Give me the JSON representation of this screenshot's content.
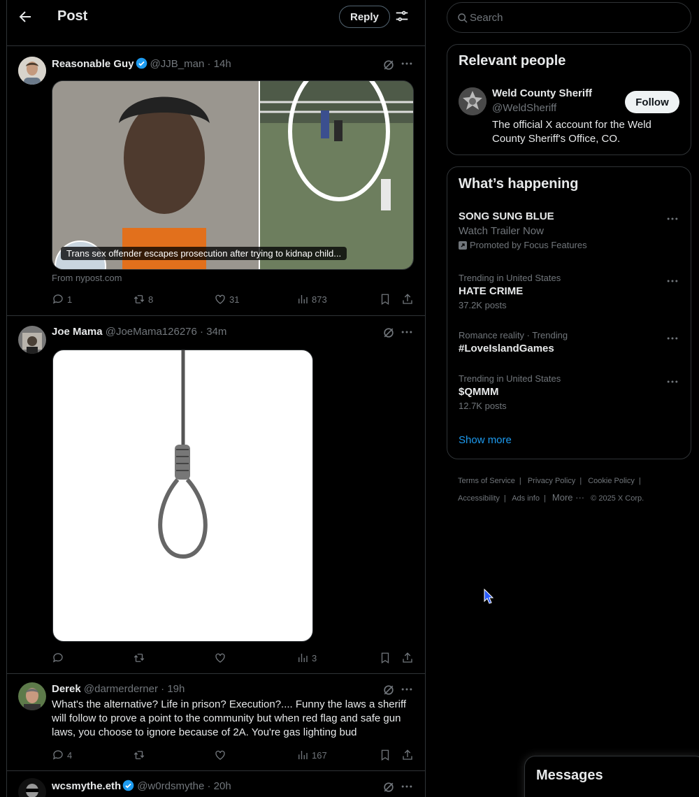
{
  "header": {
    "title": "Post",
    "reply_label": "Reply"
  },
  "tweets": [
    {
      "name": "Reasonable Guy",
      "handle": "@JJB_man",
      "time": "· 14h",
      "verified": true,
      "card_caption": "Trans sex offender escapes prosecution after trying to kidnap child...",
      "card_source": "From nypost.com",
      "replies": "1",
      "reposts": "8",
      "likes": "31",
      "views": "873"
    },
    {
      "name": "Joe Mama",
      "handle": "@JoeMama126276",
      "time": "· 34m",
      "verified": false,
      "replies": "",
      "reposts": "",
      "likes": "",
      "views": "3"
    },
    {
      "name": "Derek",
      "handle": "@darmerderner",
      "time": "· 19h",
      "verified": false,
      "text": "What's the alternative? Life in prison? Execution?.... Funny the laws a sheriff will follow to prove a point to the community but when red flag and safe gun laws, you choose to ignore because of 2A. You're gas lighting bud",
      "replies": "4",
      "reposts": "",
      "likes": "",
      "views": "167"
    },
    {
      "name": "wcsmythe.eth",
      "handle": "@w0rdsmythe",
      "time": "· 20h",
      "verified": true
    }
  ],
  "search": {
    "placeholder": "Search"
  },
  "relevant": {
    "title": "Relevant people",
    "name": "Weld County Sheriff",
    "handle": "@WeldSheriff",
    "bio": "The official X account for the Weld County Sheriff's Office, CO.",
    "follow_label": "Follow"
  },
  "happening": {
    "title": "What’s happening",
    "promo": {
      "topic": "SONG SUNG BLUE",
      "sub": "Watch Trailer Now",
      "promoted": "Promoted by Focus Features"
    },
    "trends": [
      {
        "meta": "Trending in United States",
        "topic": "HATE CRIME",
        "count": "37.2K posts"
      },
      {
        "meta": "Romance reality · Trending",
        "topic": "#LoveIslandGames",
        "count": ""
      },
      {
        "meta": "Trending in United States",
        "topic": "$QMMM",
        "count": "12.7K posts"
      }
    ],
    "show_more": "Show more"
  },
  "footer": {
    "terms": "Terms of Service",
    "privacy": "Privacy Policy",
    "cookie": "Cookie Policy",
    "accessibility": "Accessibility",
    "ads": "Ads info",
    "more": "More ···",
    "copyright": "© 2025 X Corp."
  },
  "messages": {
    "title": "Messages"
  },
  "colors": {
    "accent": "#1d9bf0",
    "border": "#2f3336",
    "muted": "#71767b",
    "text": "#e7e9ea"
  }
}
